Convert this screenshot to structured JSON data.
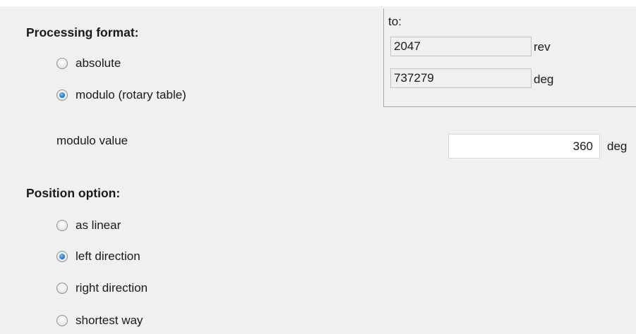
{
  "range_group": {
    "to_label": "to:",
    "rev_value": "2047",
    "rev_unit": "rev",
    "deg_value": "737279",
    "deg_unit": "deg"
  },
  "processing_format": {
    "heading": "Processing format:",
    "options": [
      {
        "label": "absolute",
        "selected": false
      },
      {
        "label": "modulo (rotary table)",
        "selected": true
      }
    ],
    "modulo_label": "modulo value",
    "modulo_value": "360",
    "modulo_unit": "deg"
  },
  "position_option": {
    "heading": "Position option:",
    "options": [
      {
        "label": "as linear",
        "selected": false
      },
      {
        "label": "left direction",
        "selected": true
      },
      {
        "label": "right direction",
        "selected": false
      },
      {
        "label": "shortest way",
        "selected": false
      }
    ]
  }
}
